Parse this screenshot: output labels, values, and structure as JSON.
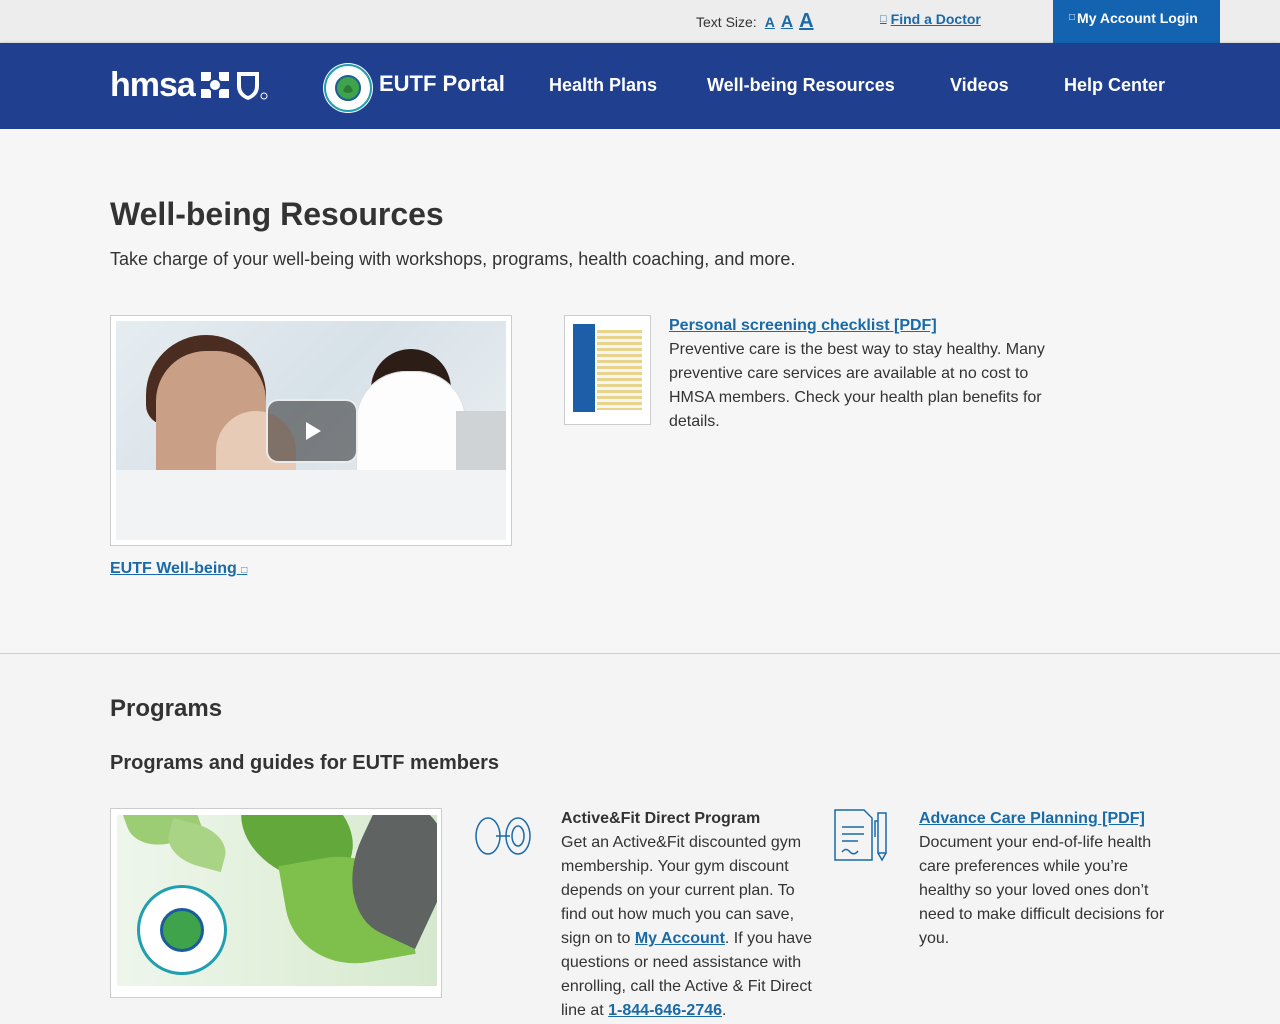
{
  "utility_bar": {
    "text_size_label": "Text Size:",
    "text_size_small": "A",
    "text_size_medium": "A",
    "text_size_large": "A",
    "find_doctor_icon": "external-link-icon",
    "find_doctor": "Find a Doctor",
    "account_icon": "lock-icon",
    "account_login": "My Account Login"
  },
  "nav": {
    "logo_text": "hmsa",
    "portal_title": "EUTF Portal",
    "items": [
      "Health Plans",
      "Well-being Resources",
      "Videos",
      "Help Center"
    ]
  },
  "hero": {
    "title": "Well-being Resources",
    "intro": "Take charge of your well-being with workshops, programs, health coaching, and more.",
    "video_link": "EUTF Well-being",
    "video_link_icon": "external-link-icon",
    "checklist_link": "Personal screening checklist [PDF]",
    "checklist_desc": "Preventive care is the best way to stay healthy. Many preventive care services are available at no cost to HMSA members. Check your health plan benefits for details."
  },
  "programs": {
    "title": "Programs",
    "subtitle": "Programs and guides for EUTF members",
    "active_fit": {
      "heading": "Active&Fit Direct Program",
      "desc_part1": "Get an Active&Fit discounted gym membership. Your gym discount depends on your current plan. To find out how much you can save, sign on to ",
      "my_account_link": "My Account",
      "desc_part2": ". If you have questions or need assistance with enrolling, call the Active & Fit Direct line at ",
      "phone_link": "1-844-646-2746",
      "desc_part3": "."
    },
    "acp": {
      "link": "Advance Care Planning [PDF]",
      "desc": "Document your end-of-life health care preferences while you’re healthy so your loved ones don’t need to make difficult decisions for you."
    }
  },
  "colors": {
    "nav_blue": "#213f8f",
    "link_blue": "#1a6aa8",
    "account_button": "#1363b0"
  }
}
